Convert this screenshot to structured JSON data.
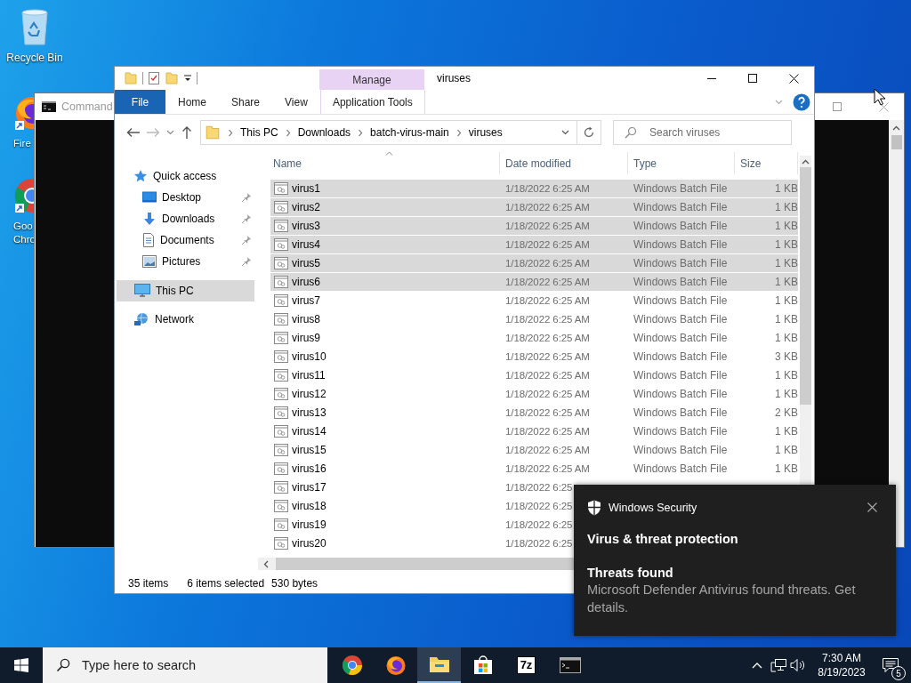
{
  "desktop_icons": [
    {
      "kind": "recycle-bin",
      "lines": [
        "Recycle Bin"
      ]
    },
    {
      "kind": "firefox",
      "lines": [
        "Fire"
      ]
    },
    {
      "kind": "chrome",
      "lines": [
        "Goo",
        "Chro"
      ]
    }
  ],
  "command_window": {
    "title": "Command"
  },
  "explorer": {
    "context_group": "Manage",
    "title": "viruses",
    "ribbon_tabs": [
      {
        "label": "File",
        "kind": "file"
      },
      {
        "label": "Home",
        "kind": "tab"
      },
      {
        "label": "Share",
        "kind": "tab"
      },
      {
        "label": "View",
        "kind": "tab"
      },
      {
        "label": "Application Tools",
        "kind": "context"
      }
    ],
    "breadcrumb": [
      "This PC",
      "Downloads",
      "batch-virus-main",
      "viruses"
    ],
    "search": {
      "placeholder": "Search viruses"
    },
    "nav": [
      {
        "label": "Quick access",
        "kind": "quick-access",
        "selected": false,
        "children": [
          {
            "label": "Desktop",
            "kind": "desktop",
            "pinned": true,
            "selected": false
          },
          {
            "label": "Downloads",
            "kind": "downloads",
            "pinned": true,
            "selected": false
          },
          {
            "label": "Documents",
            "kind": "documents",
            "pinned": true,
            "selected": false
          },
          {
            "label": "Pictures",
            "kind": "pictures",
            "pinned": true,
            "selected": false
          }
        ]
      },
      {
        "label": "This PC",
        "kind": "pc",
        "selected": true
      },
      {
        "label": "Network",
        "kind": "network",
        "selected": false
      }
    ],
    "columns": [
      "Name",
      "Date modified",
      "Type",
      "Size"
    ],
    "rows": [
      {
        "name": "virus1",
        "date": "1/18/2022 6:25 AM",
        "type": "Windows Batch File",
        "size": "1 KB",
        "selected": true
      },
      {
        "name": "virus2",
        "date": "1/18/2022 6:25 AM",
        "type": "Windows Batch File",
        "size": "1 KB",
        "selected": true
      },
      {
        "name": "virus3",
        "date": "1/18/2022 6:25 AM",
        "type": "Windows Batch File",
        "size": "1 KB",
        "selected": true
      },
      {
        "name": "virus4",
        "date": "1/18/2022 6:25 AM",
        "type": "Windows Batch File",
        "size": "1 KB",
        "selected": true
      },
      {
        "name": "virus5",
        "date": "1/18/2022 6:25 AM",
        "type": "Windows Batch File",
        "size": "1 KB",
        "selected": true
      },
      {
        "name": "virus6",
        "date": "1/18/2022 6:25 AM",
        "type": "Windows Batch File",
        "size": "1 KB",
        "selected": true
      },
      {
        "name": "virus7",
        "date": "1/18/2022 6:25 AM",
        "type": "Windows Batch File",
        "size": "1 KB",
        "selected": false
      },
      {
        "name": "virus8",
        "date": "1/18/2022 6:25 AM",
        "type": "Windows Batch File",
        "size": "1 KB",
        "selected": false
      },
      {
        "name": "virus9",
        "date": "1/18/2022 6:25 AM",
        "type": "Windows Batch File",
        "size": "1 KB",
        "selected": false
      },
      {
        "name": "virus10",
        "date": "1/18/2022 6:25 AM",
        "type": "Windows Batch File",
        "size": "3 KB",
        "selected": false
      },
      {
        "name": "virus11",
        "date": "1/18/2022 6:25 AM",
        "type": "Windows Batch File",
        "size": "1 KB",
        "selected": false
      },
      {
        "name": "virus12",
        "date": "1/18/2022 6:25 AM",
        "type": "Windows Batch File",
        "size": "1 KB",
        "selected": false
      },
      {
        "name": "virus13",
        "date": "1/18/2022 6:25 AM",
        "type": "Windows Batch File",
        "size": "2 KB",
        "selected": false
      },
      {
        "name": "virus14",
        "date": "1/18/2022 6:25 AM",
        "type": "Windows Batch File",
        "size": "1 KB",
        "selected": false
      },
      {
        "name": "virus15",
        "date": "1/18/2022 6:25 AM",
        "type": "Windows Batch File",
        "size": "1 KB",
        "selected": false
      },
      {
        "name": "virus16",
        "date": "1/18/2022 6:25 AM",
        "type": "Windows Batch File",
        "size": "1 KB",
        "selected": false
      },
      {
        "name": "virus17",
        "date": "1/18/2022 6:25",
        "selected": false
      },
      {
        "name": "virus18",
        "date": "1/18/2022 6:25",
        "selected": false
      },
      {
        "name": "virus19",
        "date": "1/18/2022 6:25",
        "selected": false
      },
      {
        "name": "virus20",
        "date": "1/18/2022 6:25",
        "selected": false
      }
    ],
    "status": {
      "count": "35 items",
      "selection": "6 items selected",
      "size": "530 bytes"
    }
  },
  "notification": {
    "app": "Windows Security",
    "title": "Virus & threat protection",
    "heading": "Threats found",
    "body": "Microsoft Defender Antivirus found threats. Get details."
  },
  "taskbar": {
    "search_placeholder": "Type here to search",
    "apps": [
      {
        "kind": "chrome",
        "active": false
      },
      {
        "kind": "firefox",
        "active": false
      },
      {
        "kind": "explorer",
        "active": true
      },
      {
        "kind": "store",
        "active": false
      },
      {
        "kind": "sevenzip",
        "label": "7z",
        "active": false
      },
      {
        "kind": "cmd",
        "active": false
      }
    ],
    "time": "7:30 AM",
    "date": "8/19/2023",
    "notification_count": "5"
  }
}
